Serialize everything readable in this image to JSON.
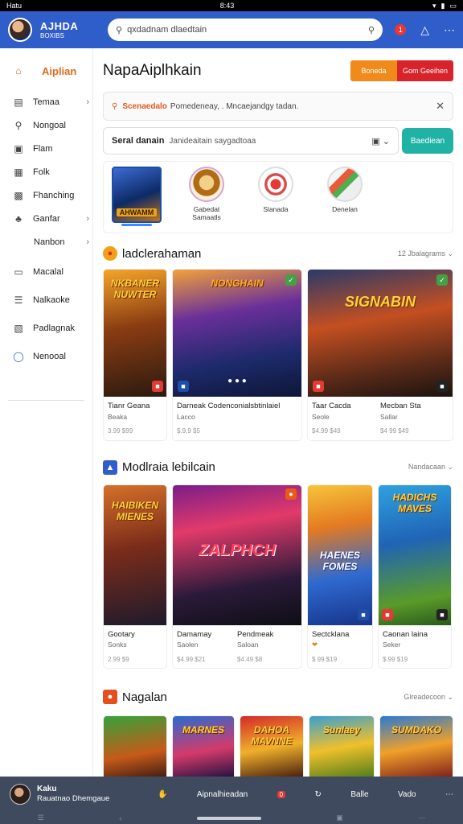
{
  "status_bar": {
    "left": "Hatu",
    "time": "8:43",
    "icons": [
      "wifi-icon",
      "signal-icon",
      "battery-icon"
    ]
  },
  "app_bar": {
    "brand_title": "AJHDA",
    "brand_subtitle": "BOXIBS",
    "search_placeholder": "qxdadnam dlaedtain",
    "notification_count": "1"
  },
  "sidebar": {
    "items": [
      {
        "label": "Aiplian",
        "icon": "home-icon",
        "active": true
      },
      {
        "label": "Temaa",
        "icon": "cart-icon",
        "chevron": true
      },
      {
        "label": "Nongoal",
        "icon": "pin-icon"
      },
      {
        "label": "Flam",
        "icon": "building-icon"
      },
      {
        "label": "Folk",
        "icon": "box-icon"
      },
      {
        "label": "Fhanching",
        "icon": "calendar-icon"
      },
      {
        "label": "Ganfar",
        "icon": "gamepad-icon",
        "chevron": true
      },
      {
        "label": "Nanbon",
        "sub": true,
        "chevron": true
      },
      {
        "label": "Macalal",
        "icon": "monitor-icon"
      },
      {
        "label": "Nalkaoke",
        "icon": "list-icon"
      },
      {
        "label": "Padlagnak",
        "icon": "chart-icon"
      },
      {
        "label": "Nenooal",
        "icon": "help-icon"
      }
    ]
  },
  "main": {
    "title": "NapaAiplhkain",
    "btn_a": "Boneda",
    "btn_b": "Gom Geeihen",
    "banner": {
      "highlight": "Scenaedalo",
      "text": "Pomedeneay, . Mncaejandgy tadan."
    },
    "filter": {
      "label": "Seral danain",
      "value": "Janideaitain saygadtoaa",
      "button": "Baediean"
    },
    "quick_items": [
      {
        "label": "",
        "tag": "AHWAMM"
      },
      {
        "label": "Gabedat Samaatls"
      },
      {
        "label": "Slanada"
      },
      {
        "label": "Denelan"
      }
    ],
    "sections": [
      {
        "title": "ladclerahaman",
        "more": "12 Jbalagrams",
        "cards": [
          {
            "art_text": "NKBANER NUWTER",
            "title": "Tianr Geana",
            "sub": "Beaka",
            "price": "3.99 $99"
          },
          {
            "art_text": "NONGHAIN",
            "title": "Darneak",
            "title2": "Codenconialsbtinlaiel",
            "sub": "Lacco",
            "price": "$.9,9 $5"
          },
          {
            "art_text": "SIGNABIN",
            "title": "Taar Cacda",
            "title2": "Mecban Sta",
            "sub": "Seole",
            "sub2": "Sallar",
            "price": "$4.99 $49",
            "price2": "$4 99 $49"
          }
        ]
      },
      {
        "title": "Modlraia lebilcain",
        "more": "Nandacaan",
        "cards": [
          {
            "art_text": "HAIBIKEN MIENES",
            "title": "Gootary",
            "sub": "Sonks",
            "price": "2.99 $9"
          },
          {
            "art_text": "ZALPHCH",
            "title": "Damamay",
            "title2": "Pendmeak",
            "sub": "Saolen",
            "sub2": "Saloan",
            "price": "$4.99 $21",
            "price2": "$4.49 $8"
          },
          {
            "art_text": "HAENES FOMES",
            "title": "Sectcklana",
            "sub": "❤",
            "price": "$ 99 $19"
          },
          {
            "art_text": "HADICHS MAVES",
            "title": "Caonan laina",
            "sub": "Seker",
            "price": "$.99 $19"
          }
        ]
      },
      {
        "title": "Nagalan",
        "more": "Glreadecoon",
        "cards": [
          {
            "art_text": ""
          },
          {
            "art_text": "MARNES"
          },
          {
            "art_text": "DAHOA MAVNNE"
          },
          {
            "art_text": "Sunlaey"
          },
          {
            "art_text": "SUMDAKO"
          }
        ]
      }
    ]
  },
  "bottom_bar": {
    "user_name": "Kaku",
    "user_sub": "Rauatnao Dhemgaue",
    "nav": [
      "Aipnalhieadan",
      "Balle",
      "Vado"
    ],
    "badge": "0"
  }
}
